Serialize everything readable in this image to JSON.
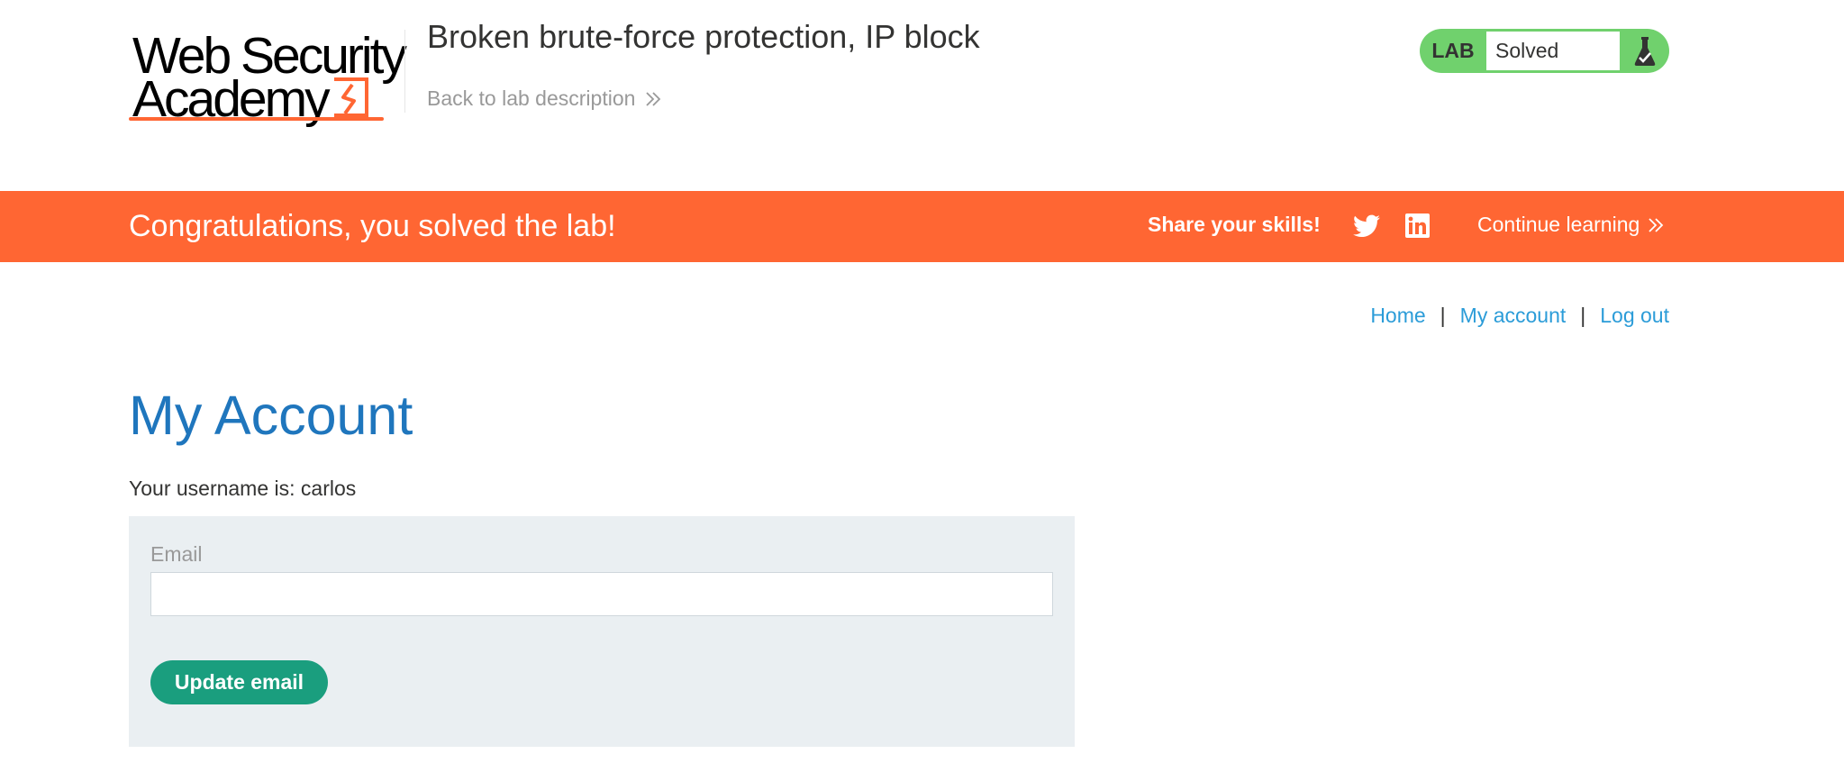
{
  "header": {
    "logo_line1": "Web Security",
    "logo_line2": "Academy",
    "lab_title": "Broken brute-force protection, IP block",
    "back_link": "Back to lab description",
    "status": {
      "lab_label": "LAB",
      "state": "Solved",
      "icon": "flask-check-icon",
      "color": "#70d16d"
    }
  },
  "banner": {
    "message": "Congratulations, you solved the lab!",
    "share_label": "Share your skills!",
    "social": [
      "twitter-icon",
      "linkedin-icon"
    ],
    "continue_label": "Continue learning",
    "color": "#ff6633"
  },
  "nav": {
    "home": "Home",
    "separator": "|",
    "my_account": "My account",
    "logout": "Log out"
  },
  "main": {
    "title": "My Account",
    "username_line": "Your username is: carlos",
    "form": {
      "email_label": "Email",
      "email_value": "",
      "submit_label": "Update email",
      "button_color": "#1a9e7e"
    }
  }
}
